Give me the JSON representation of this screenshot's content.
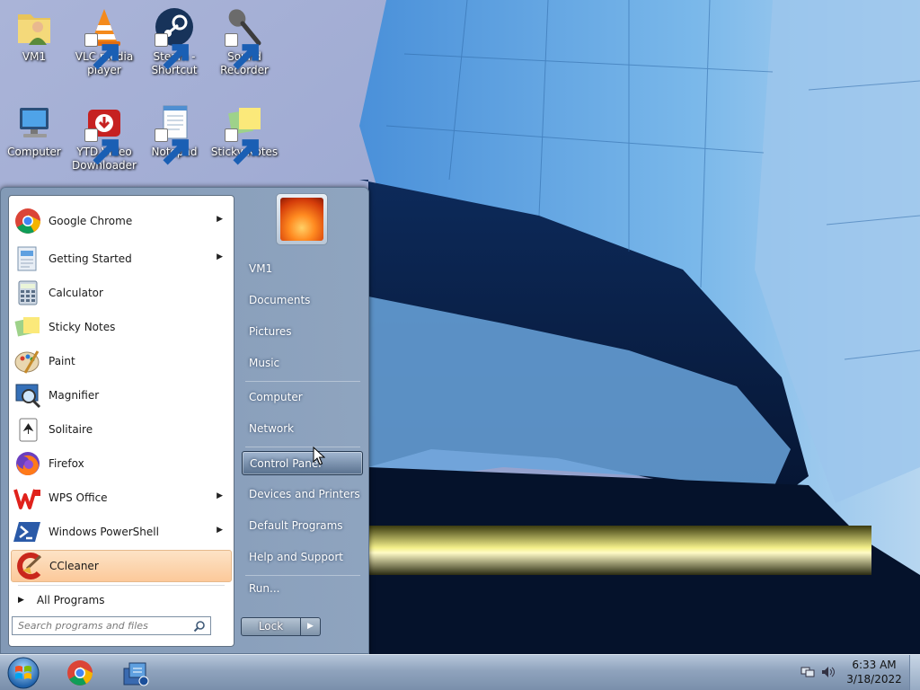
{
  "desktop": {
    "icons": [
      {
        "label": "VM1"
      },
      {
        "label": "VLC media player"
      },
      {
        "label": "Steam - Shortcut"
      },
      {
        "label": "Sound Recorder"
      },
      {
        "label": "Computer"
      },
      {
        "label": "YTD Video Downloader"
      },
      {
        "label": "Notepad"
      },
      {
        "label": "Sticky Notes"
      }
    ]
  },
  "start_menu": {
    "programs": [
      {
        "label": "Google Chrome",
        "icon": "chrome-icon",
        "has_submenu": true
      },
      {
        "label": "Getting Started",
        "icon": "getting-started-icon",
        "has_submenu": true
      },
      {
        "label": "Calculator",
        "icon": "calculator-icon",
        "has_submenu": false
      },
      {
        "label": "Sticky Notes",
        "icon": "sticky-notes-icon",
        "has_submenu": false
      },
      {
        "label": "Paint",
        "icon": "paint-icon",
        "has_submenu": false
      },
      {
        "label": "Magnifier",
        "icon": "magnifier-icon",
        "has_submenu": false
      },
      {
        "label": "Solitaire",
        "icon": "solitaire-icon",
        "has_submenu": false
      },
      {
        "label": "Firefox",
        "icon": "firefox-icon",
        "has_submenu": false
      },
      {
        "label": "WPS Office",
        "icon": "wps-office-icon",
        "has_submenu": true
      },
      {
        "label": "Windows PowerShell",
        "icon": "powershell-icon",
        "has_submenu": true
      },
      {
        "label": "CCleaner",
        "icon": "ccleaner-icon",
        "has_submenu": false,
        "highlighted": true
      }
    ],
    "all_programs_label": "All Programs",
    "search_placeholder": "Search programs and files",
    "right_items": [
      {
        "label": "VM1"
      },
      {
        "label": "Documents"
      },
      {
        "label": "Pictures"
      },
      {
        "label": "Music"
      },
      {
        "label": "Computer"
      },
      {
        "label": "Network"
      },
      {
        "label": "Control Panel",
        "hovered": true
      },
      {
        "label": "Devices and Printers"
      },
      {
        "label": "Default Programs"
      },
      {
        "label": "Help and Support"
      },
      {
        "label": "Run..."
      }
    ],
    "lock_label": "Lock",
    "lock_arrow": "▶"
  },
  "taskbar": {
    "pinned": [
      "chrome-icon",
      "network-app-icon"
    ],
    "clock_time": "6:33 AM",
    "clock_date": "3/18/2022"
  },
  "colors": {
    "highlight": "#fcc99a",
    "menu_right_pane": "#8a9fb8",
    "taskbar": "#8fa3bd"
  }
}
